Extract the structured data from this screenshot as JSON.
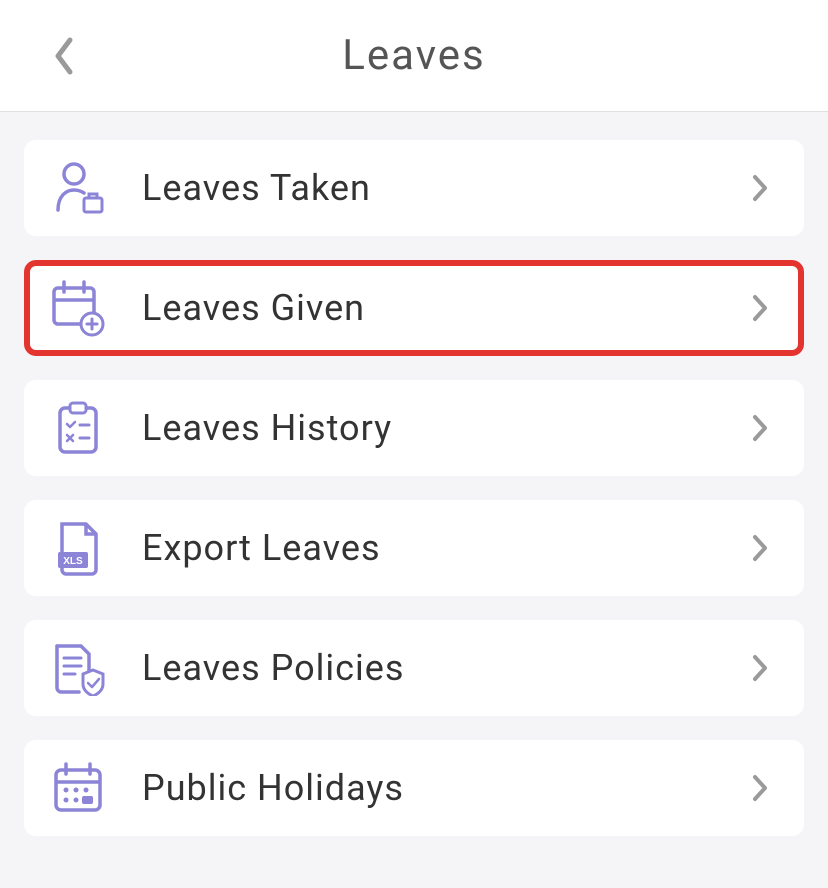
{
  "header": {
    "title": "Leaves"
  },
  "menu": {
    "items": [
      {
        "label": "Leaves Taken",
        "icon": "person-bag",
        "highlighted": false
      },
      {
        "label": "Leaves Given",
        "icon": "calendar-plus",
        "highlighted": true
      },
      {
        "label": "Leaves History",
        "icon": "clipboard-check",
        "highlighted": false
      },
      {
        "label": "Export Leaves",
        "icon": "file-xls",
        "highlighted": false
      },
      {
        "label": "Leaves Policies",
        "icon": "document-shield",
        "highlighted": false
      },
      {
        "label": "Public Holidays",
        "icon": "calendar-dots",
        "highlighted": false
      }
    ]
  },
  "colors": {
    "iconPurple": "#8b84d7",
    "chevronGray": "#9a9a9a",
    "highlightRed": "#e3342f"
  }
}
